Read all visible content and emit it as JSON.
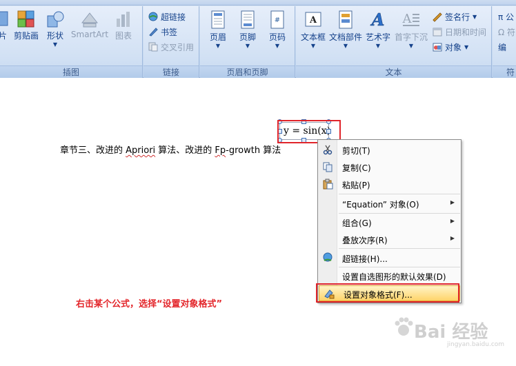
{
  "ribbon": {
    "groups": {
      "illustrations": {
        "label": "插图",
        "buttons": {
          "picture_partial": "片",
          "clipart": "剪贴画",
          "shapes": "形状",
          "smartart": "SmartArt",
          "chart": "图表"
        }
      },
      "links": {
        "label": "链接",
        "hyperlink": "超链接",
        "bookmark": "书签",
        "cross_reference": "交叉引用"
      },
      "header_footer": {
        "label": "页眉和页脚",
        "header": "页眉",
        "footer": "页脚",
        "page_number": "页码"
      },
      "text": {
        "label": "文本",
        "textbox": "文本框",
        "quick_parts": "文档部件",
        "wordart": "艺术字",
        "drop_cap": "首字下沉",
        "signature_line": "签名行",
        "date_time": "日期和时间",
        "object": "对象"
      },
      "symbols_partial": {
        "label": "符",
        "pi": "π 公",
        "omega": "Ω 符",
        "third": "编"
      }
    }
  },
  "document": {
    "text_before": "章节三、改进的 ",
    "apriori": "Apriori",
    "text_mid": " 算法、改进的 ",
    "fp": "Fp",
    "text_after": "-growth 算法",
    "equation": "y = sin(x)"
  },
  "context_menu": {
    "items": [
      {
        "label": "剪切(T)",
        "icon": "scissors-icon"
      },
      {
        "label": "复制(C)",
        "icon": "copy-icon"
      },
      {
        "label": "粘贴(P)",
        "icon": "paste-icon"
      },
      {
        "label": "“Equation” 对象(O)",
        "submenu": true
      },
      {
        "label": "组合(G)",
        "submenu": true
      },
      {
        "label": "叠放次序(R)",
        "submenu": true
      },
      {
        "label": "超链接(H)...",
        "icon": "globe-link-icon"
      },
      {
        "label": "设置自选图形的默认效果(D)"
      },
      {
        "label": "设置对象格式(F)...",
        "icon": "format-object-icon",
        "highlighted": true
      }
    ]
  },
  "instruction": "右击某个公式，选择“设置对象格式”",
  "watermark": {
    "text": "Bai  经验",
    "sub": "jingyan.baidu.com"
  },
  "colors": {
    "annotation_red": "#e0242a",
    "ribbon_text": "#15428b",
    "menu_highlight": "#ffd46a"
  }
}
